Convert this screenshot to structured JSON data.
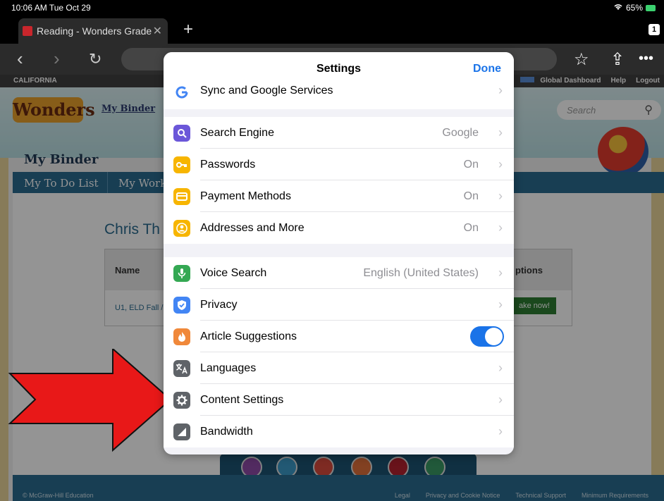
{
  "statusbar": {
    "time": "10:06 AM  Tue Oct 29",
    "battery": "65%"
  },
  "browser": {
    "tab_title": "Reading - Wonders Grade",
    "tab_count": "1",
    "new_tab": "+",
    "close_tab": "✕"
  },
  "webpage": {
    "state": "CALIFORNIA",
    "top_links": [
      "Global Dashboard",
      "Help",
      "Logout"
    ],
    "logo": "Wonders",
    "my_binder_link": "My Binder",
    "search_placeholder": "Search",
    "page_title": "My Binder",
    "nav": [
      "My To Do List",
      "My Work"
    ],
    "user_name": "Chris Th",
    "table": {
      "col_name": "Name",
      "col_options": "ptions",
      "row1_name": "U1, ELD Fall /",
      "row1_action": "ake now!"
    },
    "footer": {
      "copyright": "© McGraw-Hill Education",
      "links": [
        "Legal",
        "Privacy and Cookie Notice",
        "Technical Support",
        "Minimum Requirements"
      ]
    }
  },
  "settings": {
    "title": "Settings",
    "done": "Done",
    "rows": [
      {
        "label": "Sync and Google Services",
        "detail": ""
      },
      {
        "label": "Search Engine",
        "detail": "Google"
      },
      {
        "label": "Passwords",
        "detail": "On"
      },
      {
        "label": "Payment Methods",
        "detail": "On"
      },
      {
        "label": "Addresses and More",
        "detail": "On"
      },
      {
        "label": "Voice Search",
        "detail": "English (United States)"
      },
      {
        "label": "Privacy",
        "detail": ""
      },
      {
        "label": "Article Suggestions",
        "detail": "",
        "toggle_on": true
      },
      {
        "label": "Languages",
        "detail": ""
      },
      {
        "label": "Content Settings",
        "detail": ""
      },
      {
        "label": "Bandwidth",
        "detail": ""
      }
    ]
  },
  "colors": {
    "accent": "#1a73e8",
    "arrow": "#e81818",
    "nav": "#2a6b8f"
  }
}
